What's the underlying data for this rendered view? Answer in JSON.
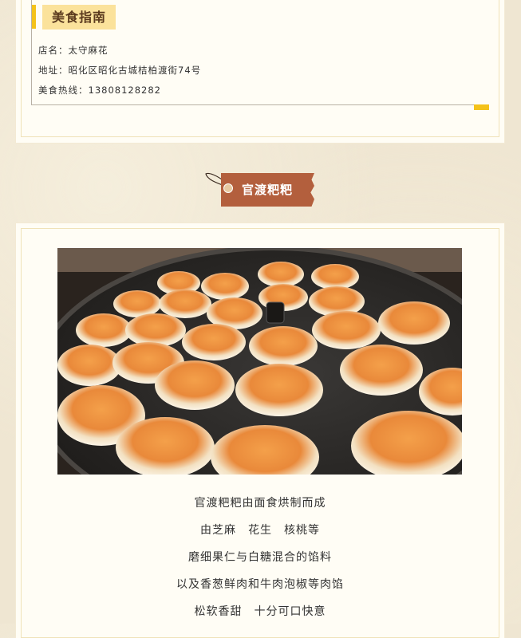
{
  "food_guide": {
    "title": "美食指南",
    "shop_label": "店名：太守麻花",
    "address_label": "地址：昭化区昭化古城桔柏渡街74号",
    "hotline_label": "美食热线：13808128282"
  },
  "section": {
    "ribbon_title": "官渡粑粑"
  },
  "description": {
    "lines": [
      "官渡粑粑由面食烘制而成",
      "由芝麻　花生　核桃等",
      "磨细果仁与白糖混合的馅料",
      "以及香葱鲜肉和牛肉泡椒等肉馅",
      "松软香甜　十分可口快意"
    ]
  },
  "colors": {
    "accent_yellow": "#f4c21a",
    "title_bg": "#fbe29b",
    "ribbon": "#b35f3d",
    "card_bg": "#fffdf5"
  }
}
